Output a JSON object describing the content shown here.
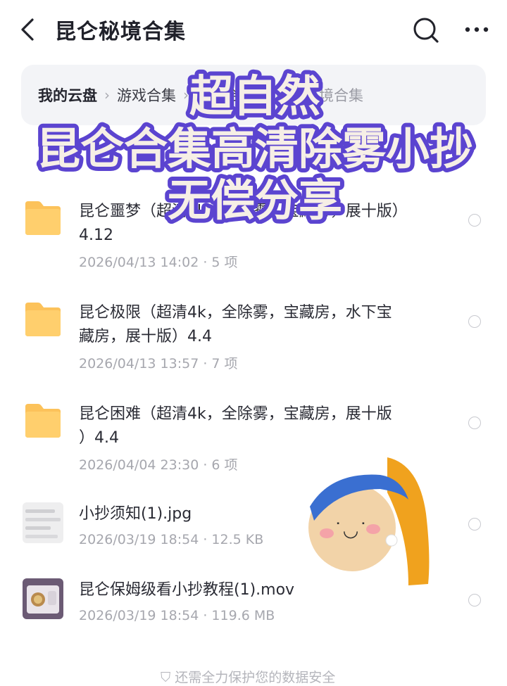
{
  "header": {
    "title": "昆仑秘境合集"
  },
  "breadcrumb": {
    "root": "我的云盘",
    "middle1": "游戏合集",
    "middle2": "秘境合集",
    "current": "昆仑秘境合集",
    "separator": "›"
  },
  "overlay": {
    "line1": "超自然",
    "line2": "昆仑合集高清除雾小抄",
    "line3": "无偿分享"
  },
  "files": [
    {
      "name_line1": "昆仑噩梦（超清4k，全除雾，宝藏房，展十版）",
      "name_line2": "4.12",
      "meta": "2026/04/13 14:02 · 5 项",
      "type": "folder"
    },
    {
      "name_line1": "昆仑极限（超清4k，全除雾，宝藏房，水下宝",
      "name_line2": "藏房，展十版）4.4",
      "meta": "2026/04/13 13:57 · 7 项",
      "type": "folder"
    },
    {
      "name_line1": "昆仑困难（超清4k，全除雾，宝藏房，展十版",
      "name_line2": "）4.4",
      "meta": "2026/04/04 23:30 · 6 项",
      "type": "folder"
    },
    {
      "name_line1": "小抄须知(1).jpg",
      "meta": "2026/03/19 18:54 · 12.5 KB",
      "type": "image"
    },
    {
      "name_line1": "昆仑保姆级看小抄教程(1).mov",
      "meta": "2026/03/19 18:54 · 119.6 MB",
      "type": "video"
    }
  ],
  "footer": {
    "text": "还需全力保护您的数据安全"
  },
  "icons": {
    "back": "chevron-left-icon",
    "search": "search-icon",
    "more": "more-dots-icon",
    "folder": "folder-icon"
  },
  "colors": {
    "folder": "#fcc25a",
    "overlay_text": "#f5eee4",
    "overlay_stroke": "#6a4fd8"
  }
}
